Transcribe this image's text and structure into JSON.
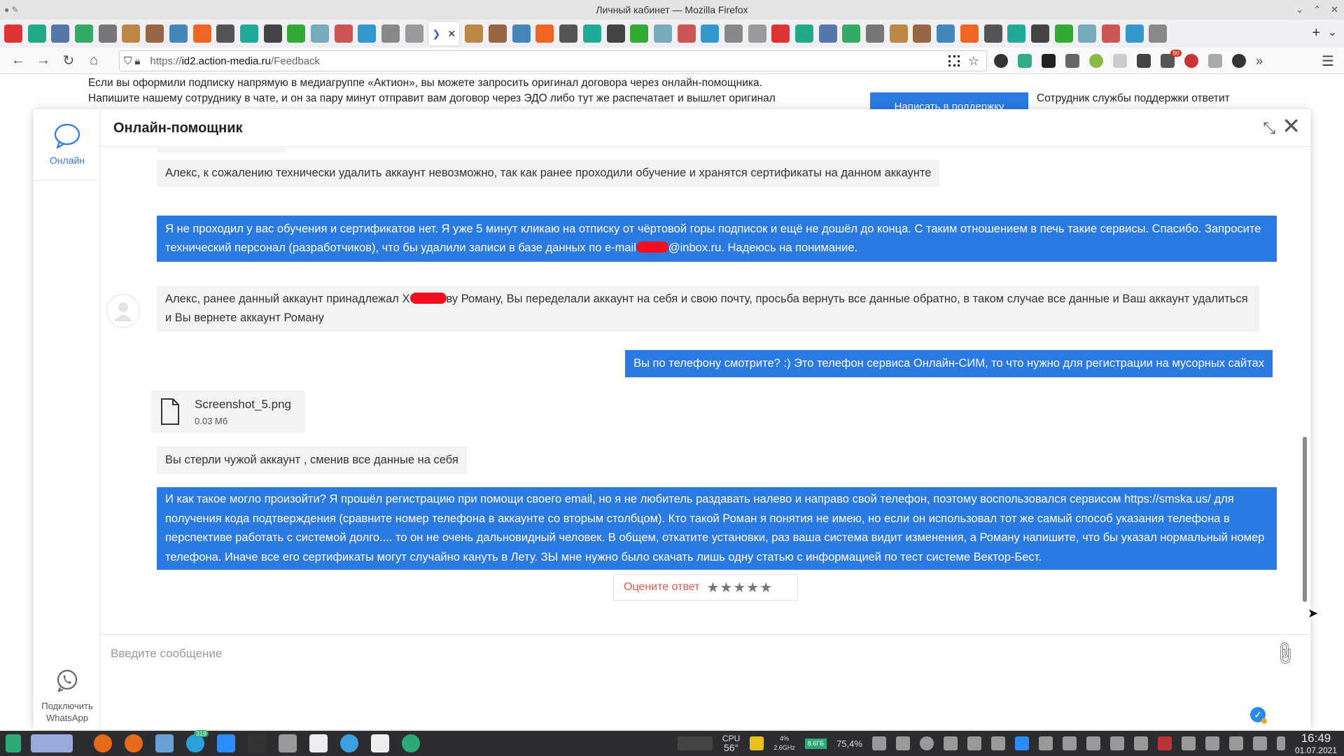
{
  "window": {
    "title": "Личный кабинет — Mozilla Firefox",
    "controls": [
      "⌄",
      "⌃",
      "✕"
    ]
  },
  "tabs": {
    "count_before_active": 18,
    "count_after_active": 30,
    "active_close": "✕",
    "active_chevron": "❯",
    "add_tab": "+",
    "list_tabs": "⌄",
    "colors": [
      "#d33",
      "#2a8",
      "#57a",
      "#3a6",
      "#777",
      "#b84",
      "#964",
      "#48b",
      "#e62",
      "#555",
      "#2a9",
      "#444",
      "#3a3",
      "#7ab",
      "#c55",
      "#39c",
      "#888",
      "#999"
    ]
  },
  "navbar": {
    "url_host": "id2.action-media.ru",
    "url_prefix": "https://",
    "url_path": "/Feedback",
    "download_badge": "80"
  },
  "page": {
    "line1": "Если вы оформили подписку напрямую в медиагруппе «Актион», вы можете запросить оригинал договора через онлайн-помощника.",
    "line2": "Напишите нашему сотруднику в чате, и он за пару минут отправит вам договор через ЭДО либо тут же распечатает и вышлет оригинал",
    "support_button": "Написать в поддержку",
    "support_side_text": "Сотрудник службы поддержки ответит"
  },
  "dialog": {
    "title": "Онлайн-помощник",
    "sidebar_online": "Онлайн",
    "whatsapp_line1": "Подключить",
    "whatsapp_line2": "WhatsApp",
    "messages": {
      "m1": "Алекс, к сожалению технически удалить аккаунт невозможно, так как ранее проходили обучение и хранятся сертификаты на данном аккаунте",
      "m2_part1": "Я не проходил у вас обучения и сертификатов нет. Я уже 5 минут кликаю на отписку от чёртовой горы подписок и ещё не дошёл до конца. С таким отношением в печь такие сервисы. Спасибо. Запросите технический персонал (разработчиков), что бы удалили записи в базе данных по e-mail",
      "m2_part2": "@inbox.ru. Надеюсь на понимание.",
      "m3_part1": "Алекс, ранее данный аккаунт принадлежал Х",
      "m3_part2": "ву Роману, Вы переделали аккаунт на себя и свою почту, просьба вернуть все данные обратно, в таком случае все данные и Ваш аккаунт удалиться и Вы вернете аккаунт Роману",
      "m4": "Вы по телефону смотрите? :) Это телефон сервиса Онлайн-СИМ, то что нужно для регистрации на мусорных сайтах",
      "file_name": "Screenshot_5.png",
      "file_size": "0.03 Мб",
      "m5": "Вы стерли чужой аккаунт , сменив все данные на себя",
      "m6": "И как такое могло произойти? Я прошёл регистрацию при помощи своего email, но я не любитель раздавать налево и направо свой телефон, поэтому воспользовался сервисом https://smska.us/ для получения кода подтверждения (сравните номер телефона в аккаунте со вторым столбцом). Кто такой Роман я понятия не имею, но если он использовал тот же самый способ указания телефона в перспективе работать с системой долго.... то он не очень дальновидный человек. В общем, откатите установки, раз ваша система видит изменения, а Роману напишите, что бы указал нормальный номер телефона. Иначе все его сертификаты могут случайно кануть в Лету. ЗЫ мне нужно было скачать лишь одну статью с информацией по тест системе Вектор-Бест."
    },
    "rate_label": "Оцените ответ",
    "rate_stars": "★★★★★",
    "rating_value": 0,
    "composer_placeholder": "Введите сообщение",
    "accent_color": "#2a7ae2"
  },
  "taskbar": {
    "cpu_label": "CPU",
    "temp": "56°",
    "cpu_load": "4%",
    "cpu_freq": "2.6GHz",
    "mem": "8.6ГБ",
    "mem_pct": "75,4%",
    "time": "16:49",
    "date": "01.07.2021",
    "launcher_badge": "319"
  }
}
